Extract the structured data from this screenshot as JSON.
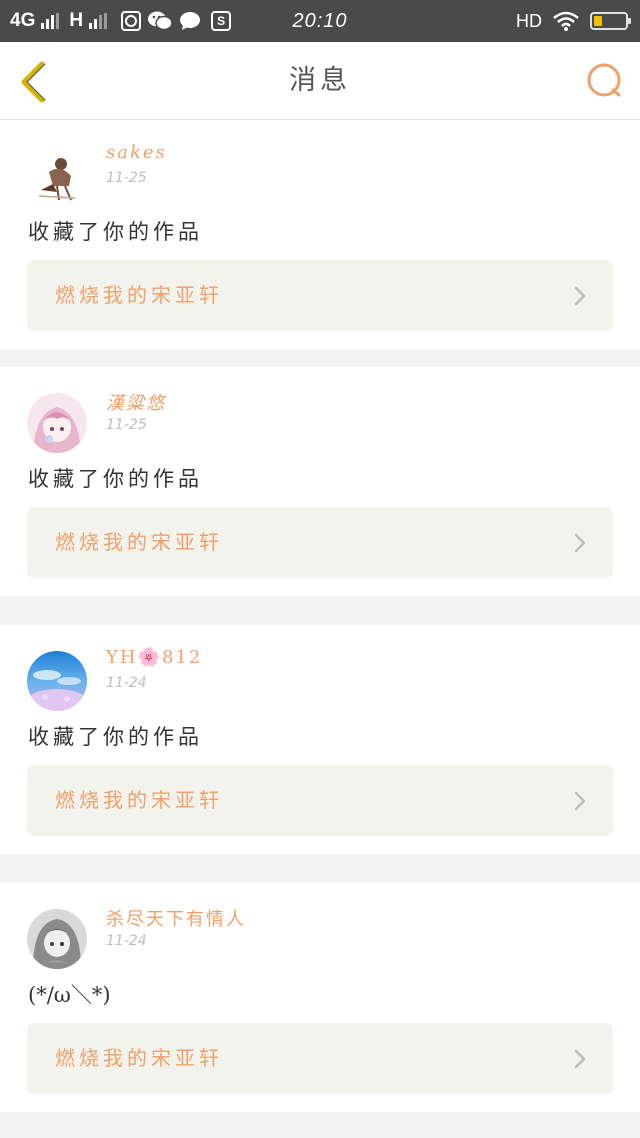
{
  "status_bar": {
    "network_1": "4G",
    "network_2": "H",
    "time": "20:10",
    "hd": "HD",
    "battery_level": 0.25,
    "icons": [
      "signal-icon",
      "app-icon",
      "wechat-icon",
      "chat-bubble-icon",
      "s-app-icon",
      "wifi-icon",
      "battery-icon"
    ]
  },
  "header": {
    "title": "消息",
    "back_icon": "back-chevron-icon",
    "search_icon": "search-icon",
    "accent": "#f0a06a",
    "back_color": "#d8b100"
  },
  "messages": [
    {
      "user": "sakes",
      "date": "11-25",
      "text": "收藏了你的作品",
      "work": "燃烧我的宋亚轩",
      "avatar": "avatar-figure-chair"
    },
    {
      "user": "漢粱悠",
      "date": "11-25",
      "text": "收藏了你的作品",
      "work": "燃烧我的宋亚轩",
      "avatar": "avatar-anime-girl-pink"
    },
    {
      "user": "YH🌸812",
      "date": "11-24",
      "text": "收藏了你的作品",
      "work": "燃烧我的宋亚轩",
      "avatar": "avatar-blue-sky-flowers"
    },
    {
      "user": "杀尽天下有情人",
      "date": "11-24",
      "text": "(*/ω＼*)",
      "work": "燃烧我的宋亚轩",
      "avatar": "avatar-anime-grayscale"
    }
  ]
}
